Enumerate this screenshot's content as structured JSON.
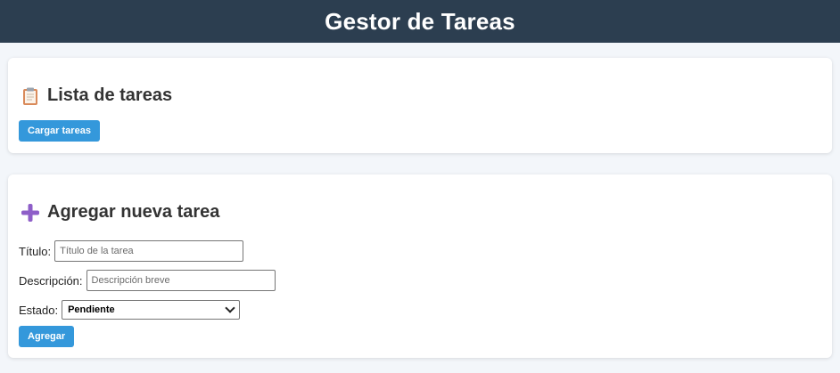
{
  "header": {
    "title": "Gestor de Tareas"
  },
  "tasks_section": {
    "icon": "clipboard-icon",
    "title": "Lista de tareas",
    "load_button": "Cargar tareas"
  },
  "add_section": {
    "icon": "plus-icon",
    "title": "Agregar nueva tarea",
    "fields": {
      "titulo": {
        "label": "Título:",
        "placeholder": "Título de la tarea",
        "value": ""
      },
      "descripcion": {
        "label": "Descripción:",
        "placeholder": "Descripción breve",
        "value": ""
      },
      "estado": {
        "label": "Estado:",
        "selected": "Pendiente"
      }
    },
    "submit_button": "Agregar"
  },
  "colors": {
    "header_bg": "#2c3e50",
    "accent": "#3498db",
    "page_bg": "#f3f6fa",
    "plus_icon": "#8e5ec8"
  }
}
